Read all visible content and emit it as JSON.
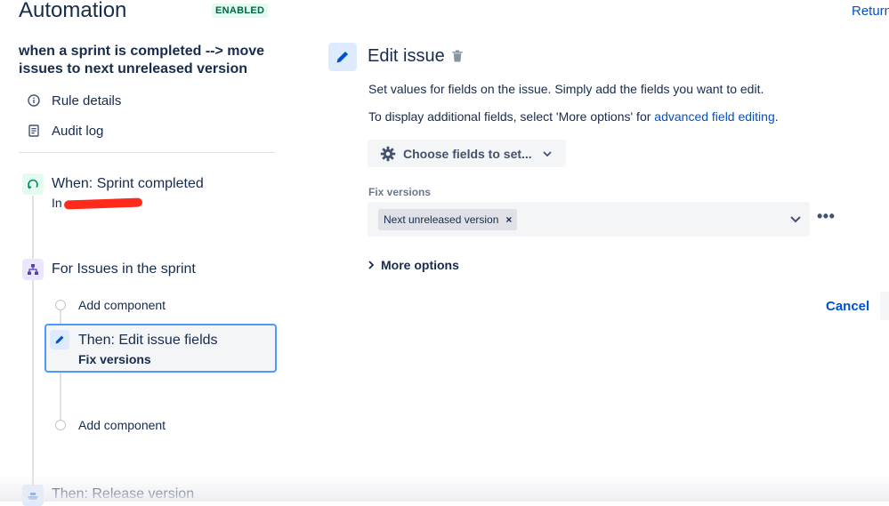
{
  "header": {
    "app_title": "Automation",
    "status_badge": "ENABLED",
    "return_link": "Return"
  },
  "rule": {
    "title": "when a sprint is completed --> move issues to next unreleased version",
    "nav": [
      {
        "label": "Rule details",
        "icon": "info-icon"
      },
      {
        "label": "Audit log",
        "icon": "document-icon"
      }
    ]
  },
  "flow": {
    "trigger": {
      "title": "When: Sprint completed",
      "subtitle": "In",
      "icon": "sprint-trigger-icon"
    },
    "branch": {
      "title": "For Issues in the sprint",
      "icon": "branch-icon"
    },
    "add_component_1": "Add component",
    "selected_action": {
      "title": "Then: Edit issue fields",
      "subtitle": "Fix versions",
      "icon": "pencil-icon"
    },
    "add_component_2": "Add component",
    "release": {
      "title": "Then: Release version",
      "icon": "ship-icon"
    }
  },
  "panel": {
    "title": "Edit issue",
    "description_1": "Set values for fields on the issue. Simply add the fields you want to edit.",
    "description_2_prefix": "To display additional fields, select 'More options' for ",
    "description_2_link": "advanced field editing",
    "description_2_suffix": ".",
    "choose_fields_label": "Choose fields to set...",
    "fix_versions_label": "Fix versions",
    "fix_versions_value": "Next unreleased version",
    "more_options_label": "More options",
    "cancel_label": "Cancel"
  },
  "colors": {
    "accent": "#0052cc",
    "enabled_bg": "#e3fcef",
    "enabled_text": "#006644",
    "selection_border": "#4c9aff"
  }
}
